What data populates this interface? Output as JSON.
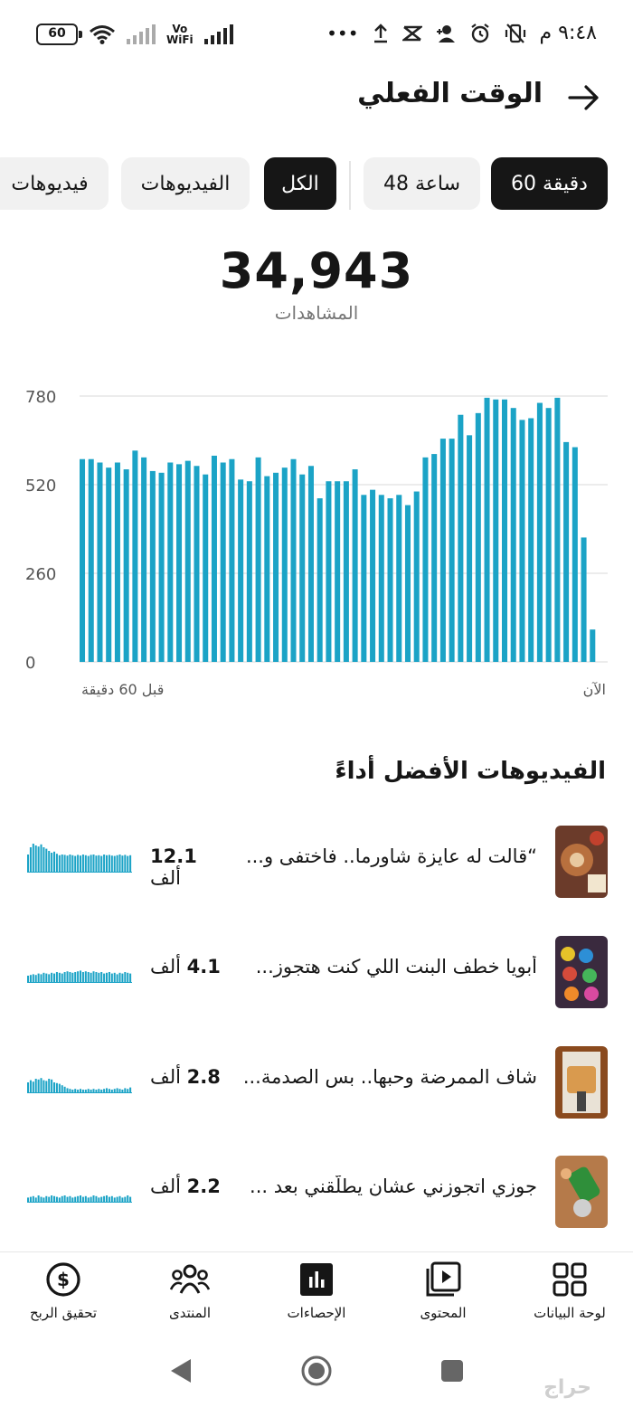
{
  "status_bar": {
    "time": "٩:٤٨ م",
    "battery": "60",
    "network_label_1": "Vo",
    "network_label_2": "WiFi",
    "overflow": "•••"
  },
  "header": {
    "title": "الوقت الفعلي"
  },
  "tabs": [
    {
      "label": "60 دقيقة",
      "active": true
    },
    {
      "label": "48 ساعة",
      "active": false
    },
    {
      "label": "الكل",
      "active": true
    },
    {
      "label": "الفيديوهات",
      "active": false
    },
    {
      "label": "فيديوهات",
      "active": false
    }
  ],
  "summary": {
    "value": "34,943",
    "label": "المشاهدات"
  },
  "chart_data": {
    "type": "bar",
    "ylim": [
      0,
      780
    ],
    "yticks": [
      "780",
      "520",
      "260",
      "0"
    ],
    "x_start_label": "قبل 60 دقيقة",
    "x_end_label": "الآن",
    "grid": true,
    "bar_color": "#1ba3c6",
    "values": [
      595,
      595,
      585,
      570,
      585,
      565,
      620,
      600,
      560,
      555,
      585,
      580,
      590,
      575,
      550,
      605,
      585,
      595,
      535,
      530,
      600,
      545,
      555,
      570,
      595,
      550,
      575,
      480,
      530,
      530,
      530,
      565,
      490,
      505,
      490,
      480,
      490,
      460,
      500,
      600,
      610,
      655,
      655,
      725,
      665,
      730,
      775,
      770,
      770,
      745,
      710,
      715,
      760,
      745,
      775,
      645,
      630,
      365,
      95
    ]
  },
  "top_videos": {
    "title": "الفيديوهات الأفضل أداءً",
    "items": [
      {
        "title": "“قالت له عايزة شاورما.. فاختفى و...",
        "count": "12.1",
        "unit": "ألف",
        "spark": [
          50,
          70,
          80,
          75,
          72,
          78,
          70,
          66,
          60,
          55,
          58,
          52,
          48,
          50,
          49,
          47,
          50,
          48,
          46,
          49,
          47,
          50,
          48,
          46,
          49,
          50,
          47,
          48,
          46,
          50,
          48,
          49,
          47,
          46,
          48,
          50,
          47,
          49,
          46,
          48
        ]
      },
      {
        "title": "أبويا خطف البنت اللي كنت هتجوز...",
        "count": "4.1",
        "unit": "ألف",
        "spark": [
          20,
          22,
          24,
          22,
          26,
          24,
          28,
          26,
          24,
          28,
          26,
          30,
          28,
          26,
          30,
          32,
          30,
          28,
          30,
          32,
          34,
          30,
          32,
          30,
          28,
          32,
          30,
          28,
          30,
          26,
          28,
          30,
          26,
          28,
          24,
          28,
          26,
          30,
          28,
          26
        ]
      },
      {
        "title": "شاف الممرضة وحبها.. بس الصدمة...",
        "count": "2.8",
        "unit": "ألف",
        "spark": [
          30,
          36,
          32,
          40,
          38,
          42,
          36,
          34,
          40,
          38,
          30,
          28,
          26,
          22,
          18,
          14,
          12,
          10,
          12,
          10,
          12,
          10,
          10,
          12,
          10,
          12,
          10,
          12,
          10,
          12,
          14,
          12,
          10,
          12,
          14,
          12,
          10,
          14,
          12,
          16
        ]
      },
      {
        "title": "جوزي اتجوزني عشان يطلّقني بعد ...",
        "count": "2.2",
        "unit": "ألف",
        "spark": [
          14,
          16,
          18,
          14,
          20,
          16,
          14,
          18,
          16,
          20,
          18,
          16,
          14,
          18,
          20,
          16,
          18,
          14,
          16,
          18,
          20,
          16,
          18,
          14,
          16,
          20,
          18,
          14,
          16,
          18,
          20,
          16,
          18,
          14,
          16,
          18,
          14,
          16,
          20,
          16
        ]
      }
    ]
  },
  "bottom_nav": [
    {
      "label": "لوحة البيانات",
      "icon": "dashboard-icon"
    },
    {
      "label": "المحتوى",
      "icon": "content-icon"
    },
    {
      "label": "الإحصاءات",
      "icon": "analytics-icon"
    },
    {
      "label": "المنتدى",
      "icon": "community-icon"
    },
    {
      "label": "تحقيق الربح",
      "icon": "monetization-icon"
    }
  ],
  "watermark": "حراج"
}
